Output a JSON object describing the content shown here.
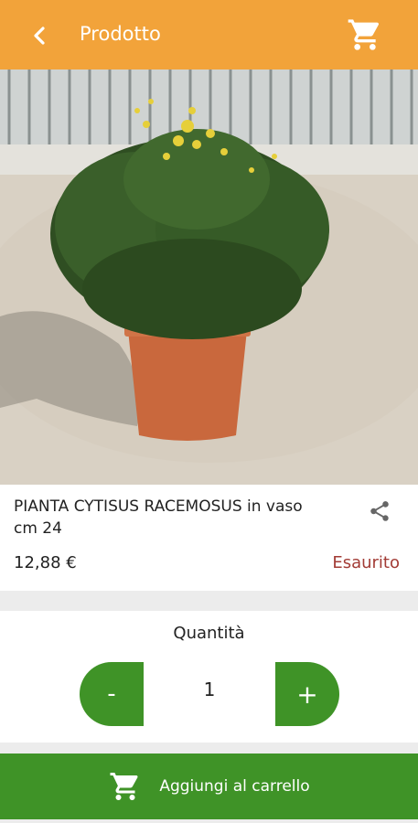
{
  "appbar": {
    "title": "Prodotto",
    "back_icon": "chevron-left-icon",
    "cart_icon": "cart-icon",
    "background": "#f2a33a"
  },
  "product": {
    "name": "PIANTA CYTISUS RACEMOSUS in vaso cm 24",
    "price": "12,88 €",
    "stock_status": "Esaurito",
    "stock_color": "#a23b35",
    "share_icon": "share-icon"
  },
  "quantity": {
    "label": "Quantità",
    "minus_label": "-",
    "plus_label": "+",
    "value": "1"
  },
  "add_to_cart": {
    "label": "Aggiungi al carrello",
    "icon": "cart-icon",
    "background": "#3f9327"
  }
}
